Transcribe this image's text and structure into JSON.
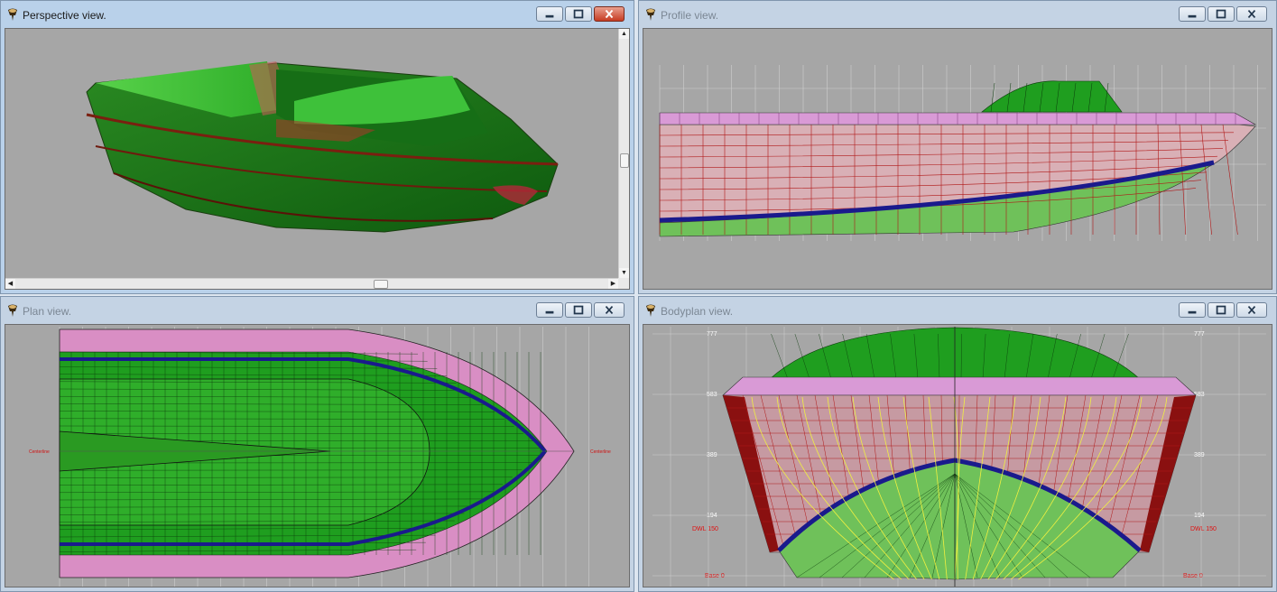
{
  "windows": {
    "perspective": {
      "title": "Perspective view."
    },
    "profile": {
      "title": "Profile view."
    },
    "plan": {
      "title": "Plan view."
    },
    "bodyplan": {
      "title": "Bodyplan view."
    }
  },
  "icons": {
    "window_app": "pin-icon",
    "minimize": "minimize-icon",
    "maximize": "maximize-icon",
    "close": "close-icon",
    "scroll_up": "arrow-up-icon",
    "scroll_down": "arrow-down-icon",
    "scroll_left": "arrow-left-icon",
    "scroll_right": "arrow-right-icon"
  },
  "plan": {
    "centerline_left": "Centerline",
    "centerline_right": "Centerline"
  },
  "bodyplan": {
    "height_labels": [
      "777",
      "583",
      "389",
      "194"
    ],
    "dwl_left": "DWL 150",
    "dwl_right": "DWL 150",
    "base_left": "Base 0",
    "base_right": "Base 0"
  },
  "colors": {
    "hull_green": "#1f9e1f",
    "deck_pink": "#d99ad6",
    "waterline_blue": "#1a1a8c",
    "station_red": "#b01818",
    "bodyplan_yellow": "#f0f040",
    "background_gray": "#a6a6a6"
  }
}
